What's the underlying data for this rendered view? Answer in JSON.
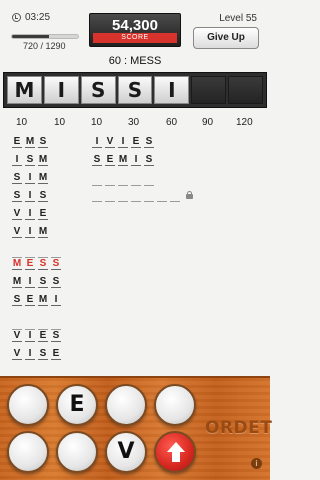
{
  "header": {
    "timer": "03:25",
    "progress_text": "720 / 1290",
    "progress_fraction": 0.558,
    "score_value": "54,300",
    "score_label": "SCORE",
    "level": "Level 55",
    "give_up_label": "Give Up",
    "word_count": "60 : MESS"
  },
  "strip": {
    "tiles": [
      "M",
      "I",
      "S",
      "S",
      "I",
      "",
      ""
    ]
  },
  "lengths": [
    "10",
    "10",
    "10",
    "30",
    "60",
    "90",
    "120"
  ],
  "columns": {
    "col1": [
      {
        "letters": [
          "E",
          "M",
          "S"
        ]
      },
      {
        "letters": [
          "I",
          "S",
          "M"
        ]
      },
      {
        "letters": [
          "S",
          "I",
          "M"
        ]
      },
      {
        "letters": [
          "S",
          "I",
          "S"
        ]
      },
      {
        "letters": [
          "V",
          "I",
          "E"
        ]
      },
      {
        "letters": [
          "V",
          "I",
          "M"
        ]
      }
    ],
    "col1b": [
      {
        "letters": [
          "M",
          "E",
          "S",
          "S"
        ],
        "highlight": true
      },
      {
        "letters": [
          "M",
          "I",
          "S",
          "S"
        ]
      },
      {
        "letters": [
          "S",
          "E",
          "M",
          "I"
        ]
      },
      {
        "letters": [
          "V",
          "I",
          "E",
          "S"
        ]
      },
      {
        "letters": [
          "V",
          "I",
          "S",
          "E"
        ]
      }
    ],
    "col3": [
      {
        "letters": [
          "I",
          "V",
          "I",
          "E",
          "S"
        ]
      },
      {
        "letters": [
          "S",
          "E",
          "M",
          "I",
          "S"
        ]
      }
    ]
  },
  "rack": {
    "disks": [
      "",
      "E",
      "",
      "",
      "",
      "",
      "V"
    ],
    "shuffle_icon": "up-arrow-icon"
  },
  "brand": "ORDET",
  "info_label": "i"
}
